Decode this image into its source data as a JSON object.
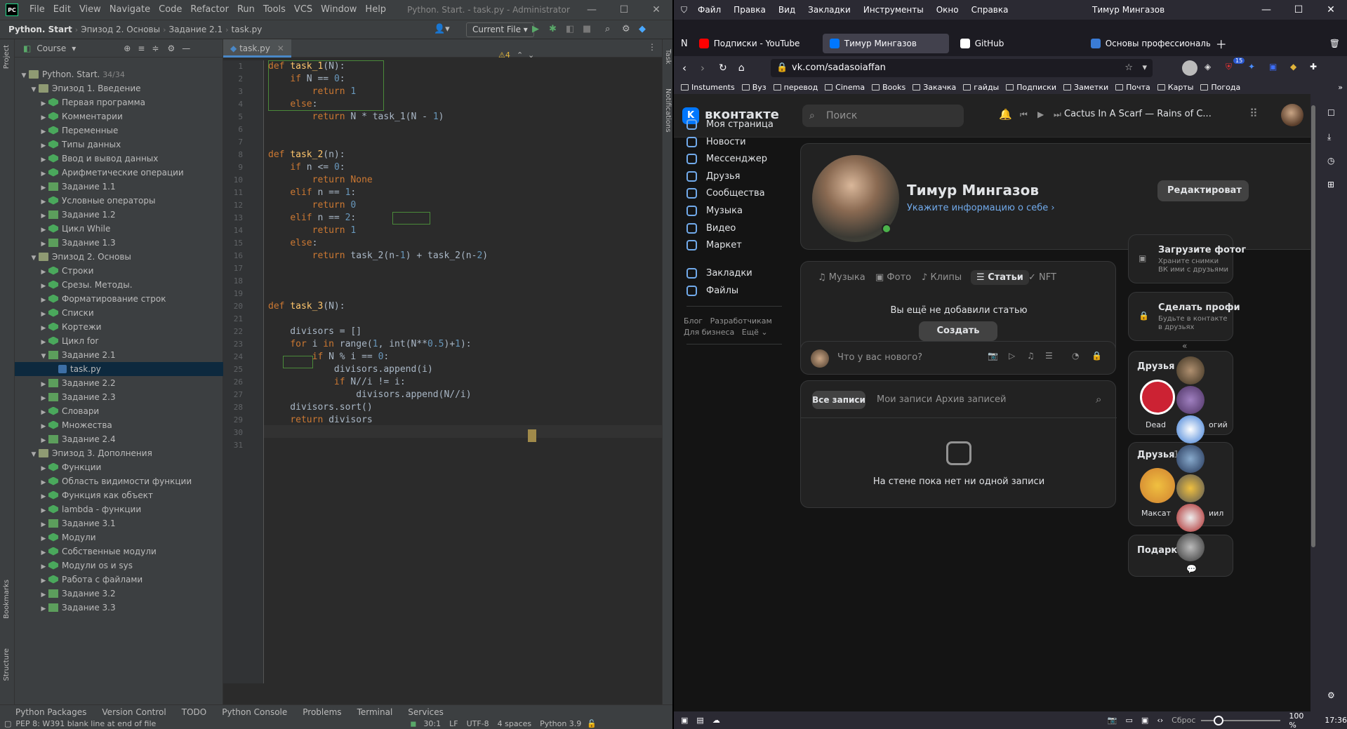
{
  "ide": {
    "menu": [
      "File",
      "Edit",
      "View",
      "Navigate",
      "Code",
      "Refactor",
      "Run",
      "Tools",
      "VCS",
      "Window",
      "Help"
    ],
    "title": "Python. Start. - task.py - Administrator",
    "breadcrumbs": [
      "Python. Start",
      "Эпизод 2. Основы",
      "Задание 2.1",
      "task.py"
    ],
    "run_config": "Current File",
    "project_label": "Course",
    "side_labels": {
      "project": "Project",
      "bookmarks": "Bookmarks",
      "structure": "Structure",
      "task": "Task",
      "notifications": "Notifications"
    },
    "root": "Python. Start.",
    "root_count": "34/34",
    "tree": [
      {
        "label": "Эпизод 1. Введение",
        "type": "folder",
        "depth": 1,
        "open": true
      },
      {
        "label": "Первая программа",
        "type": "lesson",
        "depth": 2
      },
      {
        "label": "Комментарии",
        "type": "lesson",
        "depth": 2
      },
      {
        "label": "Переменные",
        "type": "lesson",
        "depth": 2
      },
      {
        "label": "Типы данных",
        "type": "lesson",
        "depth": 2
      },
      {
        "label": "Ввод и вывод данных",
        "type": "lesson",
        "depth": 2
      },
      {
        "label": "Арифметические операции",
        "type": "lesson",
        "depth": 2
      },
      {
        "label": "Задание 1.1",
        "type": "task",
        "depth": 2
      },
      {
        "label": "Условные операторы",
        "type": "lesson",
        "depth": 2
      },
      {
        "label": "Задание 1.2",
        "type": "task",
        "depth": 2
      },
      {
        "label": "Цикл While",
        "type": "lesson",
        "depth": 2
      },
      {
        "label": "Задание 1.3",
        "type": "task",
        "depth": 2
      },
      {
        "label": "Эпизод 2. Основы",
        "type": "folder",
        "depth": 1,
        "open": true
      },
      {
        "label": "Строки",
        "type": "lesson",
        "depth": 2
      },
      {
        "label": "Срезы. Методы.",
        "type": "lesson",
        "depth": 2
      },
      {
        "label": "Форматирование строк",
        "type": "lesson",
        "depth": 2
      },
      {
        "label": "Списки",
        "type": "lesson",
        "depth": 2
      },
      {
        "label": "Кортежи",
        "type": "lesson",
        "depth": 2
      },
      {
        "label": "Цикл for",
        "type": "lesson",
        "depth": 2
      },
      {
        "label": "Задание 2.1",
        "type": "task",
        "depth": 2,
        "open": true
      },
      {
        "label": "task.py",
        "type": "py",
        "depth": 3,
        "selected": true
      },
      {
        "label": "Задание 2.2",
        "type": "task",
        "depth": 2
      },
      {
        "label": "Задание 2.3",
        "type": "task",
        "depth": 2
      },
      {
        "label": "Словари",
        "type": "lesson",
        "depth": 2
      },
      {
        "label": "Множества",
        "type": "lesson",
        "depth": 2
      },
      {
        "label": "Задание 2.4",
        "type": "task",
        "depth": 2
      },
      {
        "label": "Эпизод 3. Дополнения",
        "type": "folder",
        "depth": 1,
        "open": true
      },
      {
        "label": "Функции",
        "type": "lesson",
        "depth": 2
      },
      {
        "label": "Область видимости функции",
        "type": "lesson",
        "depth": 2
      },
      {
        "label": "Функция как объект",
        "type": "lesson",
        "depth": 2
      },
      {
        "label": "lambda - функции",
        "type": "lesson",
        "depth": 2
      },
      {
        "label": "Задание 3.1",
        "type": "task",
        "depth": 2
      },
      {
        "label": "Модули",
        "type": "lesson",
        "depth": 2
      },
      {
        "label": "Собственные модули",
        "type": "lesson",
        "depth": 2
      },
      {
        "label": "Модули os и sys",
        "type": "lesson",
        "depth": 2
      },
      {
        "label": "Работа с файлами",
        "type": "lesson",
        "depth": 2
      },
      {
        "label": "Задание 3.2",
        "type": "task",
        "depth": 2
      },
      {
        "label": "Задание 3.3",
        "type": "task",
        "depth": 2
      }
    ],
    "tab": "task.py",
    "warnings": "⚠4",
    "code": [
      "def task_1(N):",
      "    if N == 0:",
      "        return 1",
      "    else:",
      "        return N * task_1(N - 1)",
      "",
      "",
      "def task_2(n):",
      "    if n <= 0:",
      "        return None",
      "    elif n == 1:",
      "        return 0",
      "    elif n == 2:",
      "        return 1",
      "    else:",
      "        return task_2(n-1) + task_2(n-2)",
      "",
      "",
      "",
      "def task_3(N):",
      "",
      "    divisors = []",
      "    for i in range(1, int(N**0.5)+1):",
      "        if N % i == 0:",
      "            divisors.append(i)",
      "            if N//i != i:",
      "                divisors.append(N//i)",
      "    divisors.sort()",
      "    return divisors",
      "",
      ""
    ],
    "tools": [
      "Python Packages",
      "Version Control",
      "TODO",
      "Python Console",
      "Problems",
      "Terminal",
      "Services"
    ],
    "status_msg": "PEP 8: W391 blank line at end of file",
    "status_right": [
      "30:1",
      "LF",
      "UTF-8",
      "4 spaces",
      "Python 3.9"
    ]
  },
  "ff": {
    "menu": [
      "Файл",
      "Правка",
      "Вид",
      "Закладки",
      "Инструменты",
      "Окно",
      "Справка"
    ],
    "window_title": "Тимур Мингазов",
    "tabs": [
      {
        "label": "Подписки - YouTube",
        "color": "#ff0000"
      },
      {
        "label": "Тимур Мингазов",
        "color": "#0077ff",
        "active": true
      },
      {
        "label": "GitHub",
        "color": "#ffffff"
      },
      {
        "label": "Основы профессиональн",
        "color": "#3a7bd5"
      }
    ],
    "url": "vk.com/sadasoiaffan",
    "bookmarks": [
      "Instuments",
      "Вуз",
      "перевод",
      "Cinema",
      "Books",
      "Закачка",
      "гайды",
      "Подписки",
      "Заметки",
      "Почта",
      "Карты",
      "Погода"
    ],
    "zoom": "100 %",
    "reset": "Сброс",
    "time": "17:36",
    "ext_badge": "15"
  },
  "vk": {
    "logo_text": "вконтакте",
    "search_placeholder": "Поиск",
    "track": "Cactus In A Scarf — Rains of C...",
    "nav": [
      "Моя страница",
      "Новости",
      "Мессенджер",
      "Друзья",
      "Сообщества",
      "Музыка",
      "Видео",
      "Маркет"
    ],
    "nav2": [
      "Закладки",
      "Файлы"
    ],
    "footer": [
      "Блог",
      "Разработчикам",
      "Для бизнеса",
      "Ещё ⌄"
    ],
    "name": "Тимур Мингазов",
    "info_link": "Укажите информацию о себе ›",
    "edit_btn": "Редактироват",
    "content_tabs": [
      "Музыка",
      "Фото",
      "Клипы",
      "Статьи",
      "NFT"
    ],
    "empty_articles": "Вы ещё не добавили статью",
    "create_article": "Создать статью",
    "post_placeholder": "Что у вас нового?",
    "wall_tabs": [
      "Все записи",
      "Мои записи",
      "Архив записей"
    ],
    "wall_empty": "На стене пока нет ни одной записи",
    "promo1_title": "Загрузите фотог",
    "promo1_sub": "Храните снимки ВК ими с друзьями",
    "promo2_title": "Сделать профи",
    "promo2_sub": "Будьте в контакте в друзьях",
    "friends_title": "Друзья о",
    "friend1": "Dead",
    "friend1b": "огий",
    "friends2_title": "Друзья",
    "friends2_count": "1",
    "friend2": "Максат",
    "friend2b": "иил",
    "gifts_title": "Подарки"
  }
}
